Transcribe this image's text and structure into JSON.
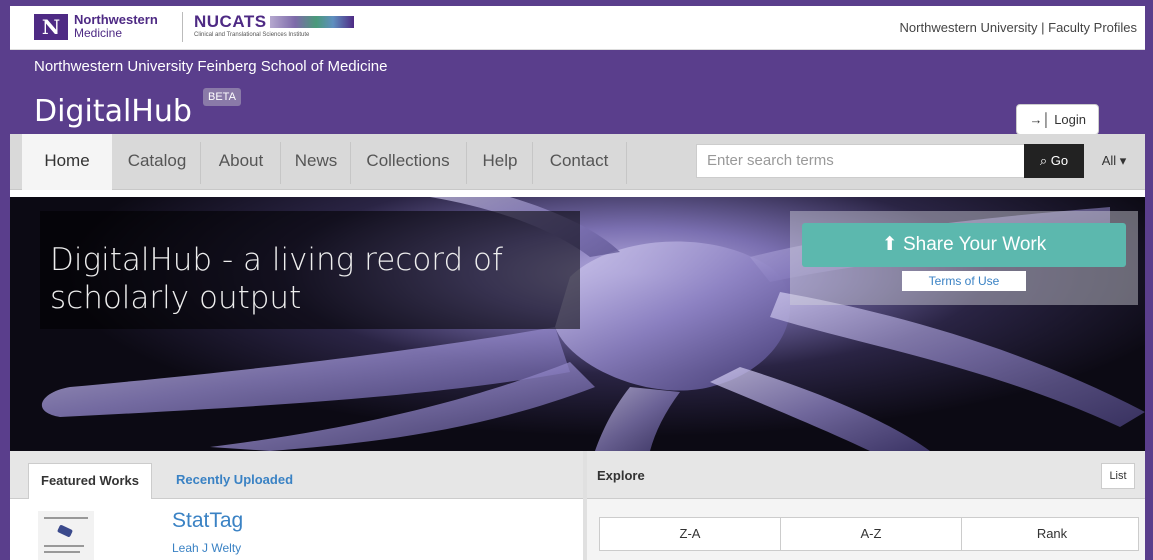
{
  "topbar": {
    "nm_line1": "Northwestern",
    "nm_line2": "Medicine",
    "nm_mark": "N",
    "nucats_title": "NUCATS",
    "nucats_subtitle": "Clinical and Translational Sciences Institute",
    "right_links": "Northwestern University | Faculty Profiles"
  },
  "header": {
    "school": "Northwestern University Feinberg School of Medicine",
    "title": "DigitalHub",
    "badge": "BETA",
    "login_label": "Login"
  },
  "nav": {
    "items": [
      "Home",
      "Catalog",
      "About",
      "News",
      "Collections",
      "Help",
      "Contact"
    ],
    "active": "Home",
    "search_placeholder": "Enter search terms",
    "go_label": "Go",
    "scope_label": "All"
  },
  "hero": {
    "headline": "DigitalHub - a living record of scholarly output",
    "share_label": "Share Your Work",
    "terms_label": "Terms of Use"
  },
  "featured": {
    "tabs": [
      "Featured Works",
      "Recently Uploaded"
    ],
    "work_title": "StatTag",
    "work_author": "Leah J Welty"
  },
  "explore": {
    "title": "Explore",
    "list_label": "List",
    "sort_options": [
      "Z-A",
      "A-Z",
      "Rank"
    ]
  },
  "colors": {
    "brand_purple": "#5a3e8c",
    "teal": "#5cb8ae",
    "link_blue": "#3a82c4"
  }
}
